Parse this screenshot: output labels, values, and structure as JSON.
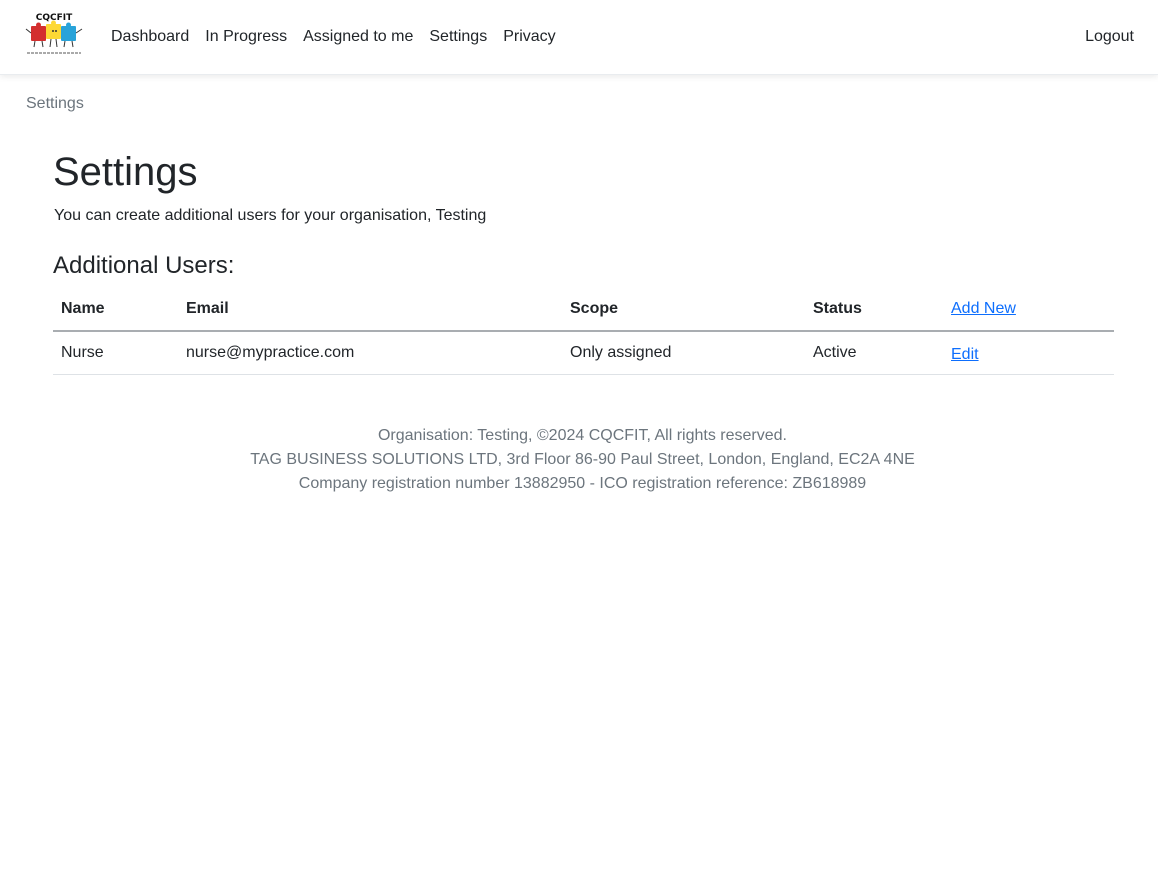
{
  "brand": {
    "logo_text": "CQCFIT"
  },
  "nav": {
    "items": [
      "Dashboard",
      "In Progress",
      "Assigned to me",
      "Settings",
      "Privacy"
    ],
    "logout_label": "Logout"
  },
  "breadcrumb": "Settings",
  "page": {
    "title": "Settings",
    "intro": "You can create additional users for your organisation, Testing",
    "section_title": "Additional Users:"
  },
  "table": {
    "headers": [
      "Name",
      "Email",
      "Scope",
      "Status"
    ],
    "add_new_label": "Add New",
    "rows": [
      {
        "name": "Nurse",
        "email": "nurse@mypractice.com",
        "scope": "Only assigned",
        "status": "Active",
        "action_label": "Edit"
      }
    ]
  },
  "footer": {
    "line1": "Organisation: Testing, ©2024 CQCFIT, All rights reserved.",
    "line2": "TAG BUSINESS SOLUTIONS LTD, 3rd Floor 86-90 Paul Street, London, England, EC2A 4NE",
    "line3": "Company registration number 13882950 - ICO registration reference: ZB618989"
  },
  "colors": {
    "link": "#0d6efd",
    "muted": "#6c757d",
    "text": "#212529"
  }
}
